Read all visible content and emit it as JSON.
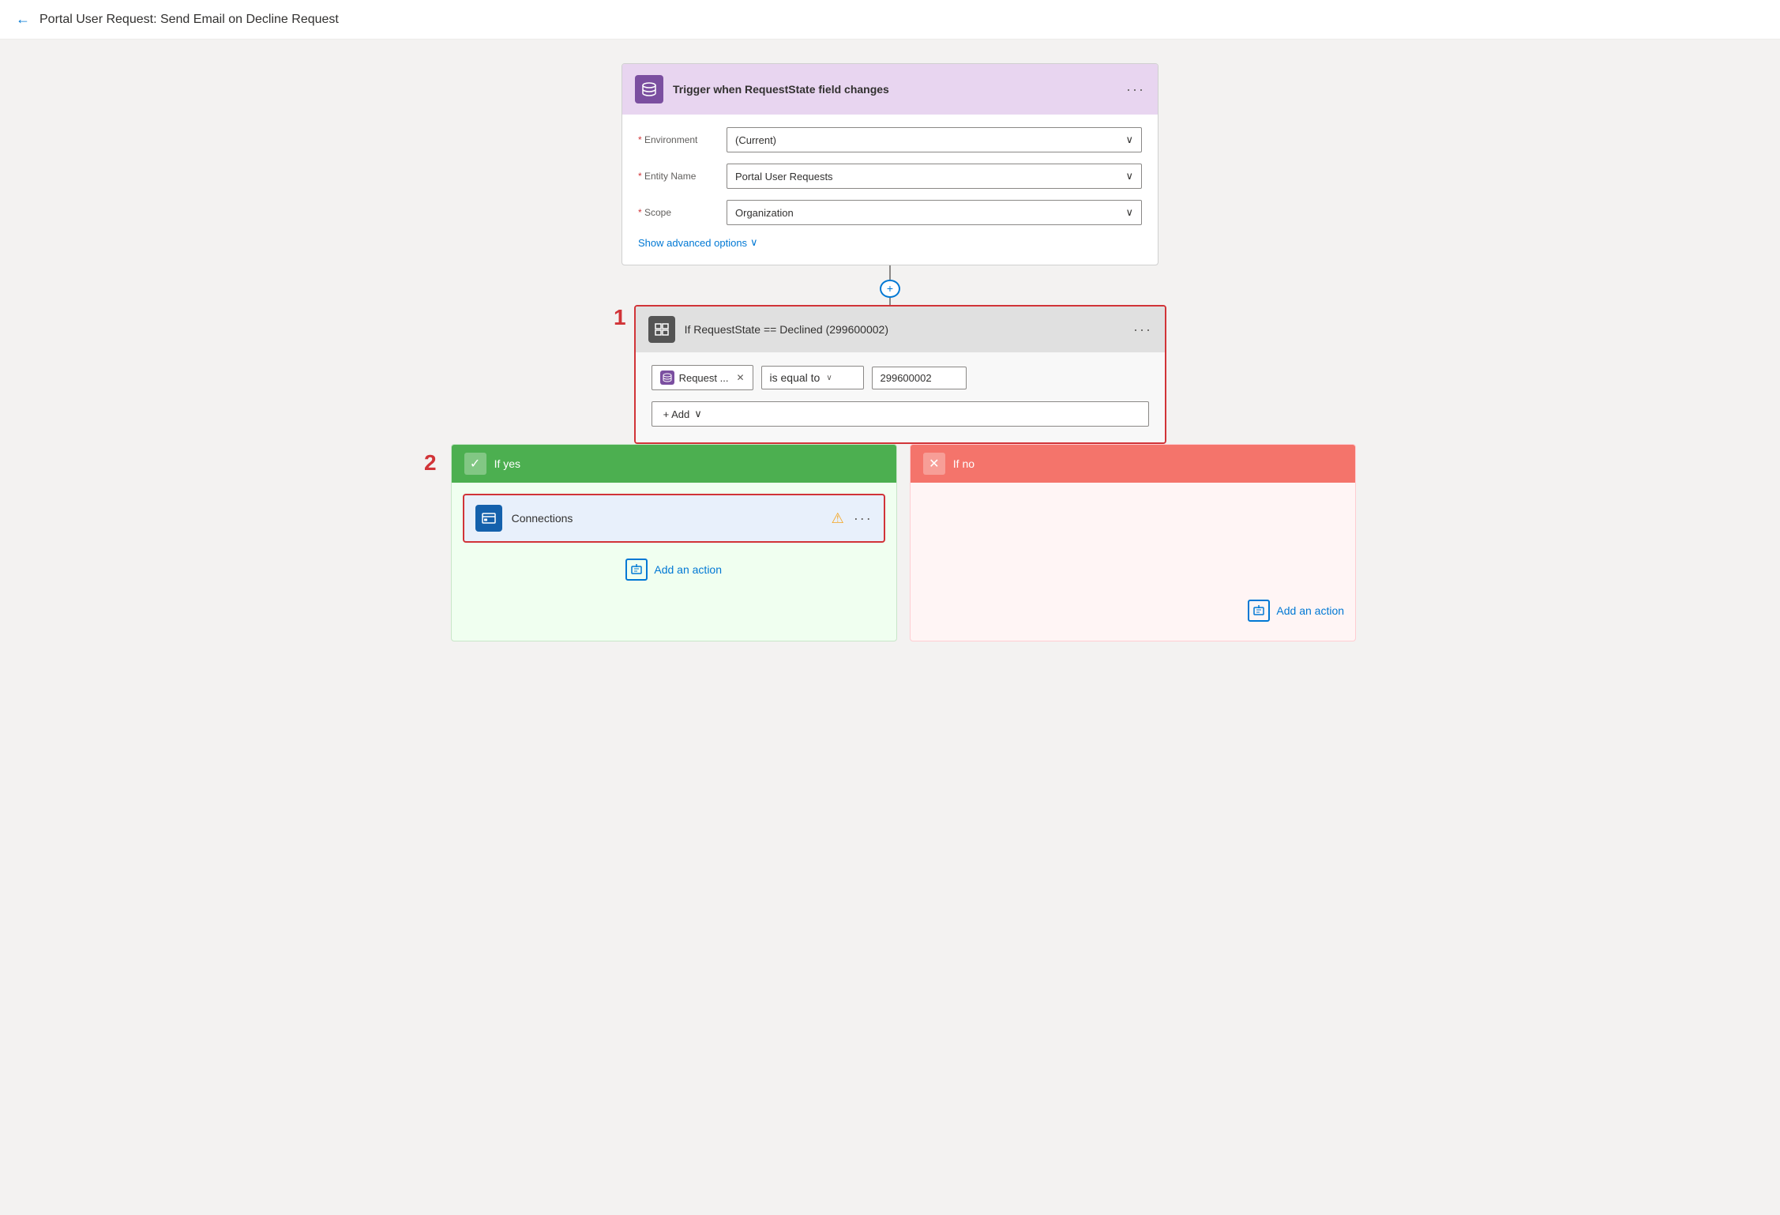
{
  "header": {
    "back_label": "←",
    "title": "Portal User Request: Send Email on Decline Request"
  },
  "trigger": {
    "icon": "🗄",
    "title": "Trigger when RequestState field changes",
    "more": "···",
    "fields": [
      {
        "label": "* Environment",
        "value": "(Current)"
      },
      {
        "label": "* Entity Name",
        "value": "Portal User Requests"
      },
      {
        "label": "* Scope",
        "value": "Organization"
      }
    ],
    "advanced_link": "Show advanced options",
    "advanced_chevron": "∨"
  },
  "connector": {
    "plus": "+"
  },
  "condition": {
    "step_number": "1",
    "icon": "⊞",
    "title": "If RequestState == Declined (299600002)",
    "more": "···",
    "token_icon": "🗄",
    "token_text": "Request ...",
    "operator_text": "is equal to",
    "value_text": "299600002",
    "add_label": "+ Add",
    "add_chevron": "∨"
  },
  "branches": {
    "yes": {
      "check": "✓",
      "label": "If yes",
      "action": {
        "icon": "O",
        "label": "Connections",
        "warning": "⚠",
        "more": "···"
      },
      "add_action_label": "Add an action"
    },
    "no": {
      "x": "✕",
      "label": "If no",
      "add_action_label": "Add an action"
    }
  },
  "step_number_2": "2"
}
